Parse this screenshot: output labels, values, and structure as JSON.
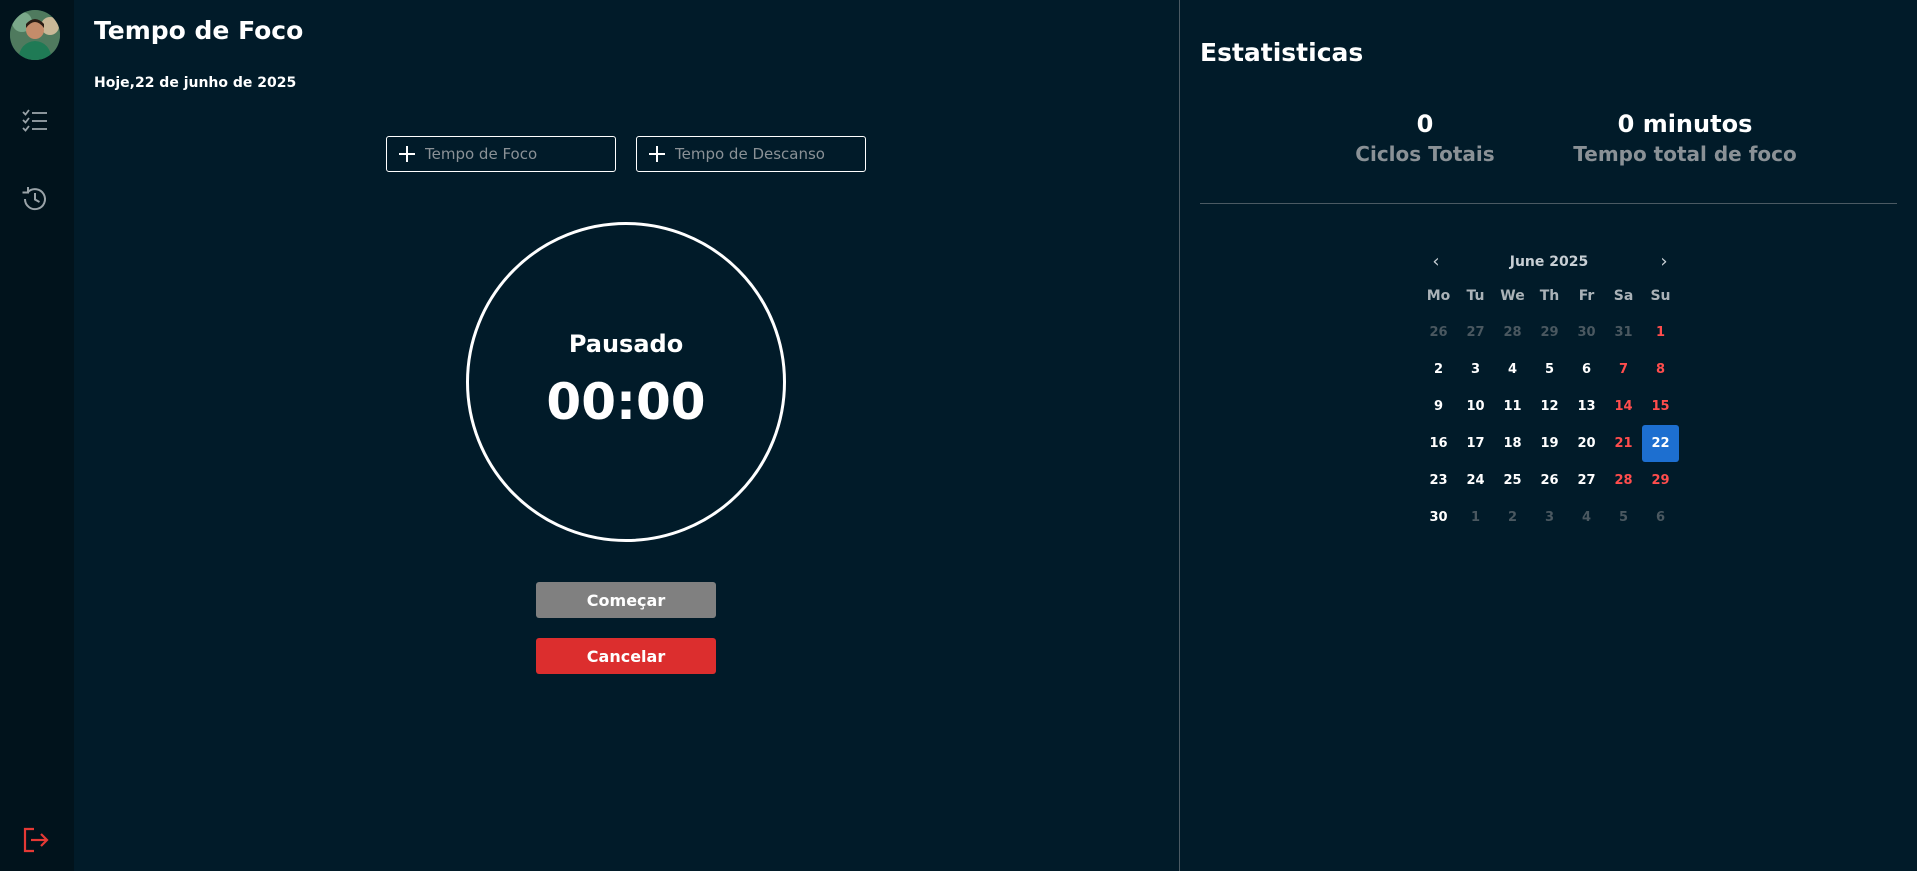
{
  "sidebar": {
    "avatar_alt": "User avatar",
    "icons": [
      "checklist-icon",
      "history-icon",
      "logout-icon"
    ]
  },
  "main": {
    "title": "Tempo de Foco",
    "date": "Hoje,22 de junho de 2025",
    "focus_input_placeholder": "Tempo de Foco",
    "rest_input_placeholder": "Tempo de Descanso",
    "timer_status": "Pausado",
    "timer_value": "00:00",
    "start_label": "Começar",
    "cancel_label": "Cancelar"
  },
  "stats": {
    "title": "Estatisticas",
    "cycles_value": "0",
    "cycles_label": "Ciclos Totais",
    "focus_value": "0 minutos",
    "focus_label": "Tempo total de foco"
  },
  "calendar": {
    "month_label": "June 2025",
    "prev": "‹",
    "next": "›",
    "weekdays": [
      "Mo",
      "Tu",
      "We",
      "Th",
      "Fr",
      "Sa",
      "Su"
    ],
    "weeks": [
      [
        {
          "d": "26",
          "o": true
        },
        {
          "d": "27",
          "o": true
        },
        {
          "d": "28",
          "o": true
        },
        {
          "d": "29",
          "o": true
        },
        {
          "d": "30",
          "o": true
        },
        {
          "d": "31",
          "o": true
        },
        {
          "d": "1",
          "w": true
        }
      ],
      [
        {
          "d": "2"
        },
        {
          "d": "3"
        },
        {
          "d": "4"
        },
        {
          "d": "5"
        },
        {
          "d": "6"
        },
        {
          "d": "7",
          "w": true
        },
        {
          "d": "8",
          "w": true
        }
      ],
      [
        {
          "d": "9"
        },
        {
          "d": "10"
        },
        {
          "d": "11"
        },
        {
          "d": "12"
        },
        {
          "d": "13"
        },
        {
          "d": "14",
          "w": true
        },
        {
          "d": "15",
          "w": true
        }
      ],
      [
        {
          "d": "16"
        },
        {
          "d": "17"
        },
        {
          "d": "18"
        },
        {
          "d": "19"
        },
        {
          "d": "20"
        },
        {
          "d": "21",
          "w": true
        },
        {
          "d": "22",
          "t": true
        }
      ],
      [
        {
          "d": "23"
        },
        {
          "d": "24"
        },
        {
          "d": "25"
        },
        {
          "d": "26"
        },
        {
          "d": "27"
        },
        {
          "d": "28",
          "w": true
        },
        {
          "d": "29",
          "w": true
        }
      ],
      [
        {
          "d": "30"
        },
        {
          "d": "1",
          "o": true
        },
        {
          "d": "2",
          "o": true
        },
        {
          "d": "3",
          "o": true
        },
        {
          "d": "4",
          "o": true
        },
        {
          "d": "5",
          "o": true
        },
        {
          "d": "6",
          "o": true
        }
      ]
    ]
  },
  "colors": {
    "background": "#011b29",
    "sidebar": "#01131c",
    "cancel": "#dc2e2e",
    "start": "#808080",
    "today": "#1d6fd0",
    "weekend": "#ff4d4d"
  }
}
